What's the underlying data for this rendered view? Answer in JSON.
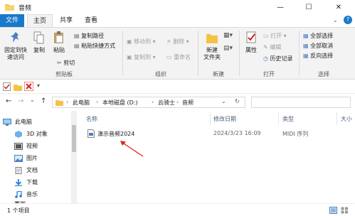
{
  "window": {
    "title": "音频",
    "minimize": "—",
    "maximize": "☐",
    "close": "✕"
  },
  "tabs": [
    "文件",
    "主页",
    "共享",
    "查看"
  ],
  "ribbon": {
    "clipboard": {
      "pin": [
        "固定到快",
        "速访问"
      ],
      "copy": "复制",
      "paste": "粘贴",
      "copy_path": "复制路径",
      "paste_shortcut": "粘贴快捷方式",
      "cut": "剪切",
      "group": "剪贴板"
    },
    "organize": {
      "move_to": "移动到 ▾",
      "copy_to": "复制到 ▾",
      "delete": "删除 ▾",
      "rename": "重命名",
      "group": "组织"
    },
    "new": {
      "new_folder": [
        "新建",
        "文件夹"
      ],
      "group": "新建"
    },
    "open": {
      "properties": "属性",
      "open": "打开 ▾",
      "edit": "编辑",
      "history": "历史记录",
      "group": "打开"
    },
    "select": {
      "select_all": "全部选择",
      "select_none": "全部取消",
      "invert": "反向选择",
      "group": "选择"
    }
  },
  "qat_arrow": "▾",
  "address": {
    "crumbs": [
      "此电脑",
      "本地磁盘 (D:)",
      "云骑士",
      "音频"
    ],
    "sep": "›",
    "dropdown": "⌄",
    "refresh": "↻",
    "back": "←",
    "forward": "→",
    "recent": "⌄",
    "up": "↑",
    "search_placeholder": ""
  },
  "nav": {
    "items": [
      "此电脑",
      "3D 对象",
      "视频",
      "图片",
      "文档",
      "下载",
      "音乐",
      "桌面"
    ]
  },
  "columns": [
    "名称",
    "修改日期",
    "类型",
    "大小"
  ],
  "files": [
    {
      "name": "演示音频2024",
      "modified": "2024/3/23 16:09",
      "type": "MIDI 序列"
    }
  ],
  "status": {
    "count": "1 个项目"
  },
  "colors": {
    "accent": "#1979ca",
    "folder": "#f3c344",
    "arrow": "#d9241c"
  }
}
